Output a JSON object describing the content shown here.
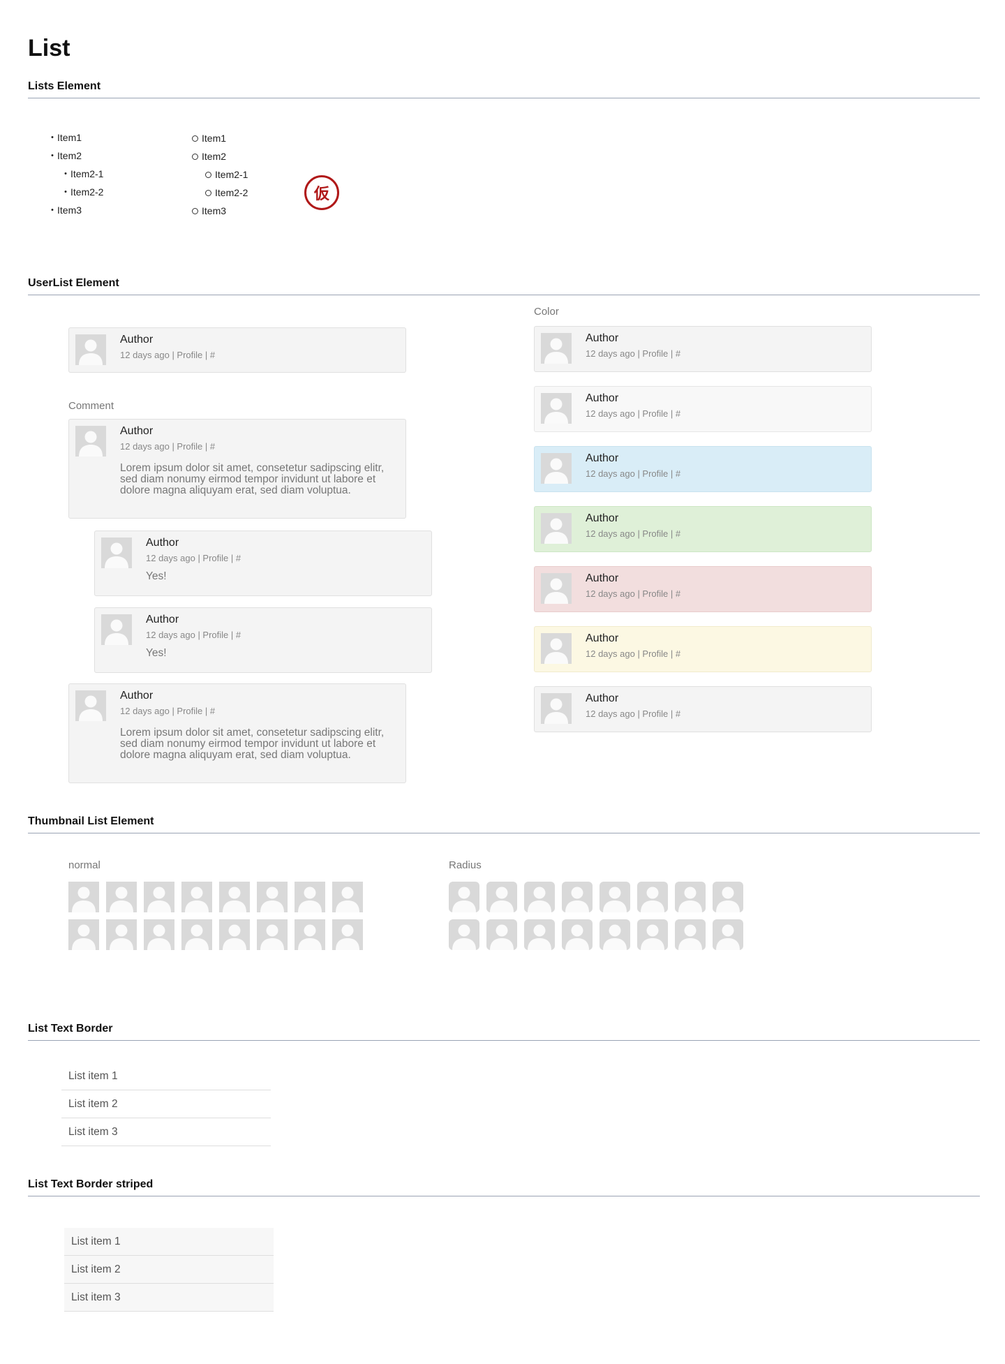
{
  "page": {
    "title": "List"
  },
  "sections": {
    "lists": "Lists Element",
    "userlist": "UserList Element",
    "thumbnail": "Thumbnail List Element",
    "text_border": "List Text Border",
    "text_border_striped": "List Text Border striped"
  },
  "lists_element": {
    "bullet": {
      "item1": "Item1",
      "item2": "Item2",
      "item2_1": "Item2-1",
      "item2_2": "Item2-2",
      "item3": "Item3"
    },
    "circle": {
      "item1": "Item1",
      "item2": "Item2",
      "item2_1": "Item2-1",
      "item2_2": "Item2-2",
      "item3": "Item3"
    },
    "stamp": "仮"
  },
  "userlist": {
    "author": "Author",
    "meta": "12 days ago | Profile | #",
    "comment_label": "Comment",
    "color_label": "Color",
    "lorem": "Lorem ipsum dolor sit amet, consetetur sadipscing elitr, sed diam nonumy eirmod tempor invidunt ut labore et dolore magna aliquyam erat, sed diam voluptua.",
    "yes": "Yes!",
    "color_cards": [
      {
        "bg": "#f4f4f4",
        "border": "#e0e0e0"
      },
      {
        "bg": "#f8f8f8",
        "border": "#e6e6e6"
      },
      {
        "bg": "#d9edf7",
        "border": "#c8e2ef"
      },
      {
        "bg": "#dff0d8",
        "border": "#cde6c4"
      },
      {
        "bg": "#f2dede",
        "border": "#e8cccc"
      },
      {
        "bg": "#fcf8e3",
        "border": "#f1ebcc"
      },
      {
        "bg": "#f4f4f4",
        "border": "#e0e0e0"
      }
    ]
  },
  "thumbnails": {
    "normal_label": "normal",
    "radius_label": "Radius"
  },
  "text_border": {
    "items": [
      "List item 1",
      "List item 2",
      "List item 3"
    ]
  },
  "text_border_striped": {
    "items": [
      "List item 1",
      "List item 2",
      "List item 3"
    ]
  }
}
